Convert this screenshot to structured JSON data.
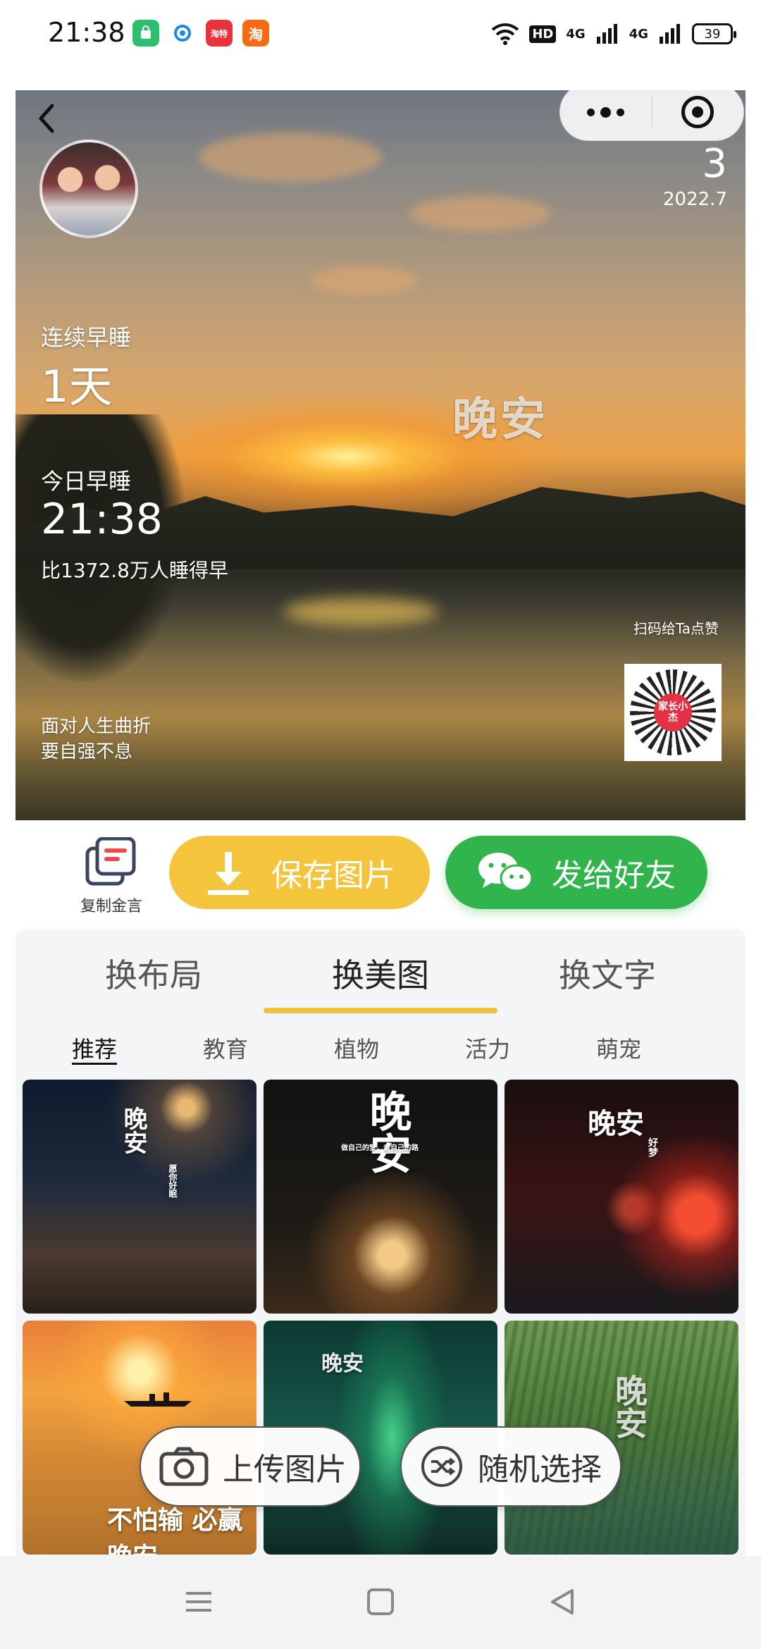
{
  "status_bar": {
    "time": "21:38",
    "apps": [
      {
        "icon": "shopping-bag-app-icon",
        "color": "#2dbf6f",
        "text": ""
      },
      {
        "icon": "browser-app-icon",
        "color": "#1e88e5",
        "text": ""
      },
      {
        "icon": "taote-app-icon",
        "color": "#e8323c",
        "text": "淘特"
      },
      {
        "icon": "taobao-app-icon",
        "color": "#f56a14",
        "text": "淘"
      }
    ],
    "hd_label": "HD",
    "network_1": "4G",
    "network_2": "4G",
    "battery": "39"
  },
  "hero": {
    "day_count": "3",
    "date": "2022.7",
    "streak_label": "连续早睡",
    "streak_value": "1天",
    "overlay_text": "晚安",
    "today_label": "今日早睡",
    "today_time": "21:38",
    "comparison": "比1372.8万人睡得早",
    "motto_line1": "面对人生曲折",
    "motto_line2": "要自强不息",
    "scan_hint": "扫码给Ta点赞",
    "qr_center_text": "家长小杰"
  },
  "actions": {
    "copy_label": "复制金言",
    "save_label": "保存图片",
    "send_label": "发给好友"
  },
  "tabs": [
    "换布局",
    "换美图",
    "换文字"
  ],
  "active_tab": 1,
  "subtabs": [
    "推荐",
    "教育",
    "植物",
    "活力",
    "萌宠"
  ],
  "active_subtab": 0,
  "gallery": [
    {
      "caption": "晚安",
      "sub": "愿你好眠"
    },
    {
      "caption": "晚安",
      "sub": "做自己的梦，走自己的路"
    },
    {
      "caption": "晚安",
      "sub": "好梦"
    },
    {
      "caption": "不怕输 必赢 晚安",
      "sub": ""
    },
    {
      "caption": "晚安",
      "sub": ""
    },
    {
      "caption": "晚安",
      "sub": ""
    }
  ],
  "floating": {
    "upload_label": "上传图片",
    "random_label": "随机选择"
  },
  "colors": {
    "save_button": "#f4c43d",
    "send_button": "#32b44c",
    "tab_underline": "#f0c13e"
  }
}
